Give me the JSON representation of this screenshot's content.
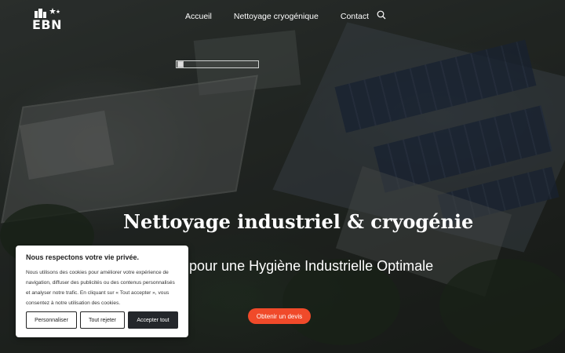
{
  "header": {
    "logo_text": "EBN",
    "nav": [
      "Accueil",
      "Nettoyage cryogénique",
      "Contact"
    ]
  },
  "hero": {
    "title": "Nettoyage industriel & cryogénie",
    "subtitle": "aire pour une Hygiène Industrielle Optimale",
    "cta_label": "Obtenir un devis"
  },
  "cookie_banner": {
    "title": "Nous respectons votre vie privée.",
    "text": "Nous utilisons des cookies pour améliorer votre expérience de navigation, diffuser des publicités ou des contenus personnalisés et analyser notre trafic. En cliquant sur « Tout accepter », vous consentez à notre utilisation des cookies.",
    "customize_label": "Personnaliser",
    "reject_label": "Tout rejeter",
    "accept_label": "Accepter tout"
  },
  "colors": {
    "accent": "#f04a2a",
    "dark_button": "#24272b"
  }
}
